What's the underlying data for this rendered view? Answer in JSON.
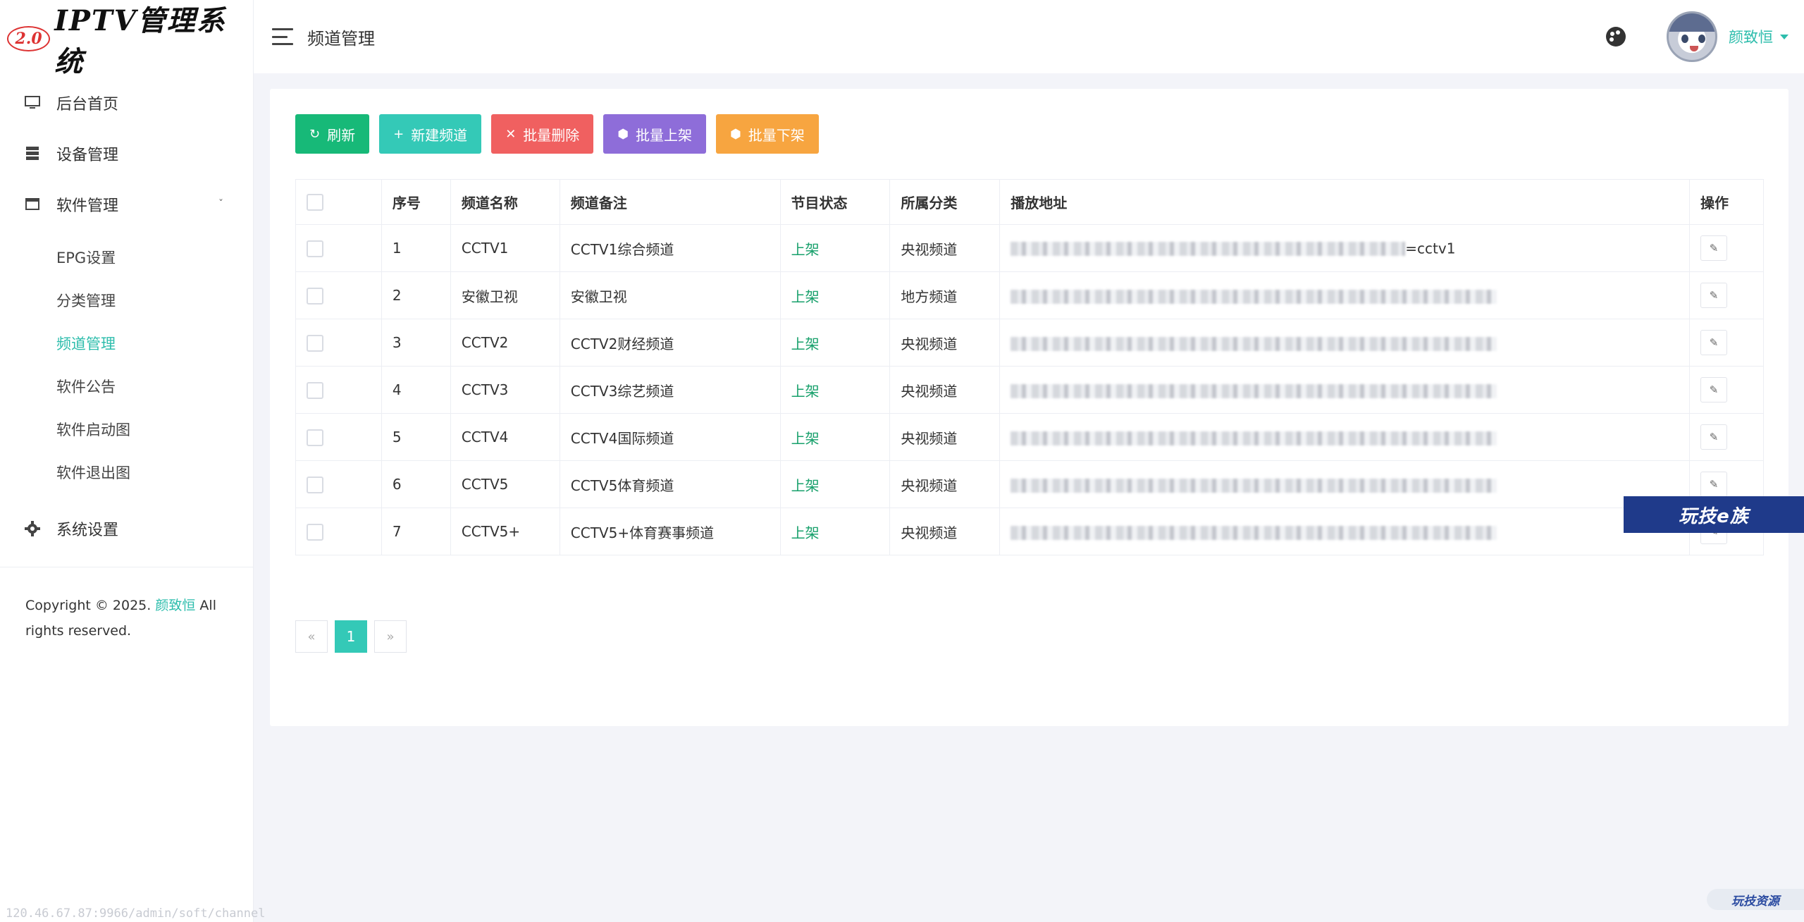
{
  "logo": {
    "badge": "2.0",
    "title": "IPTV管理系统"
  },
  "sidebar": {
    "items": [
      {
        "label": "后台首页",
        "icon": "monitor-icon"
      },
      {
        "label": "设备管理",
        "icon": "server-icon"
      },
      {
        "label": "软件管理",
        "icon": "window-icon"
      }
    ],
    "subitems": [
      {
        "label": "EPG设置"
      },
      {
        "label": "分类管理"
      },
      {
        "label": "频道管理",
        "active": true
      },
      {
        "label": "软件公告"
      },
      {
        "label": "软件启动图"
      },
      {
        "label": "软件退出图"
      }
    ],
    "settings": {
      "label": "系统设置",
      "icon": "gear-icon"
    },
    "copyright_prefix": "Copyright © 2025.",
    "copyright_author": "颜致恒",
    "copyright_suffix": "All rights reserved."
  },
  "header": {
    "title": "频道管理",
    "username": "颜致恒"
  },
  "toolbar": {
    "refresh": "刷新",
    "new_channel": "新建频道",
    "batch_delete": "批量删除",
    "batch_online": "批量上架",
    "batch_offline": "批量下架"
  },
  "table": {
    "columns": [
      "序号",
      "频道名称",
      "频道备注",
      "节目状态",
      "所属分类",
      "播放地址",
      "操作"
    ],
    "rows": [
      {
        "id": "1",
        "name": "CCTV1",
        "note": "CCTV1综合频道",
        "status": "上架",
        "category": "央视频道",
        "url_tail": "=cctv1"
      },
      {
        "id": "2",
        "name": "安徽卫视",
        "note": "安徽卫视",
        "status": "上架",
        "category": "地方频道",
        "url_tail": ""
      },
      {
        "id": "3",
        "name": "CCTV2",
        "note": "CCTV2财经频道",
        "status": "上架",
        "category": "央视频道",
        "url_tail": ""
      },
      {
        "id": "4",
        "name": "CCTV3",
        "note": "CCTV3综艺频道",
        "status": "上架",
        "category": "央视频道",
        "url_tail": ""
      },
      {
        "id": "5",
        "name": "CCTV4",
        "note": "CCTV4国际频道",
        "status": "上架",
        "category": "央视频道",
        "url_tail": ""
      },
      {
        "id": "6",
        "name": "CCTV5",
        "note": "CCTV5体育频道",
        "status": "上架",
        "category": "央视频道",
        "url_tail": ""
      },
      {
        "id": "7",
        "name": "CCTV5+",
        "note": "CCTV5+体育赛事频道",
        "status": "上架",
        "category": "央视频道",
        "url_tail": ""
      }
    ]
  },
  "pagination": {
    "prev": "«",
    "current": "1",
    "next": "»"
  },
  "watermark": {
    "main": "玩技e族",
    "corner": "玩技资源"
  },
  "status_url": "120.46.67.87:9966/admin/soft/channel",
  "colors": {
    "accent": "#2dbdac",
    "green": "#17b978",
    "teal": "#34c9b7",
    "red": "#f06060",
    "purple": "#8e6dd9",
    "orange": "#f7a540"
  }
}
